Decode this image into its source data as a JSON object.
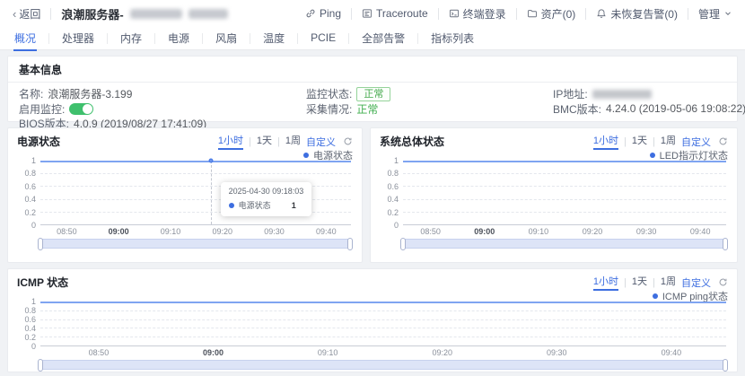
{
  "header": {
    "back_label": "返回",
    "title": "浪潮服务器-",
    "actions": [
      {
        "label": "Ping",
        "icon": "link-icon"
      },
      {
        "label": "Traceroute",
        "icon": "route-icon"
      },
      {
        "label": "终端登录",
        "icon": "terminal-icon"
      },
      {
        "label": "资产(0)",
        "icon": "folder-icon"
      },
      {
        "label": "未恢复告警(0)",
        "icon": "bell-icon"
      },
      {
        "label": "管理",
        "icon": "chevron-down-icon"
      }
    ]
  },
  "tabs": {
    "active": "概况",
    "items": [
      "概况",
      "处理器",
      "内存",
      "电源",
      "风扇",
      "温度",
      "PCIE",
      "全部告警",
      "指标列表"
    ]
  },
  "basic_info": {
    "title": "基本信息",
    "name_label": "名称:",
    "name_value": "浪潮服务器-3.199",
    "monitor_toggle_label": "启用监控:",
    "bios_label": "BIOS版本:",
    "bios_value": "4.0.9 (2019/08/27 17:41:09)",
    "monitor_status_label": "监控状态:",
    "monitor_status_value": "正常",
    "collect_label": "采集情况:",
    "collect_value": "正常",
    "ip_label": "IP地址:",
    "bmc_label": "BMC版本:",
    "bmc_value": "4.24.0 (2019-05-06 19:08:22)"
  },
  "range_picker": {
    "hour": "1小时",
    "day": "1天",
    "week": "1周",
    "custom": "自定义",
    "active": "1小时"
  },
  "colors": {
    "primary_blue": "#3D6EE0",
    "line_blue": "#7FA4F1",
    "success_green": "#3fae4e",
    "brush_fill": "#dde4f7"
  },
  "chart_data": [
    {
      "type": "line",
      "title": "电源状态",
      "legend": "电源状态",
      "x": [
        "08:50",
        "09:00",
        "09:10",
        "09:20",
        "09:30",
        "09:40"
      ],
      "y_ticks": [
        "1",
        "0.8",
        "0.6",
        "0.4",
        "0.2",
        "0"
      ],
      "ylim": [
        0,
        1
      ],
      "xrange": [
        "08:45",
        "09:45"
      ],
      "grid": true,
      "legend_position": "top-right",
      "series": [
        {
          "name": "电源状态",
          "values": [
            1,
            1,
            1,
            1,
            1,
            1
          ]
        }
      ],
      "tooltip": {
        "time": "2025-04-30 09:18:03",
        "name": "电源状态",
        "value": "1"
      }
    },
    {
      "type": "line",
      "title": "系统总体状态",
      "legend": "LED指示灯状态",
      "x": [
        "08:50",
        "09:00",
        "09:10",
        "09:20",
        "09:30",
        "09:40"
      ],
      "y_ticks": [
        "1",
        "0.8",
        "0.6",
        "0.4",
        "0.2",
        "0"
      ],
      "ylim": [
        0,
        1
      ],
      "xrange": [
        "08:45",
        "09:45"
      ],
      "grid": true,
      "legend_position": "top-right",
      "series": [
        {
          "name": "LED指示灯状态",
          "values": [
            1,
            1,
            1,
            1,
            1,
            1
          ]
        }
      ]
    },
    {
      "type": "line",
      "title": "ICMP 状态",
      "legend": "ICMP ping状态",
      "x": [
        "08:50",
        "09:00",
        "09:10",
        "09:20",
        "09:30",
        "09:40"
      ],
      "y_ticks": [
        "1",
        "0.8",
        "0.6",
        "0.4",
        "0.2",
        "0"
      ],
      "ylim": [
        0,
        1
      ],
      "xrange": [
        "08:45",
        "09:45"
      ],
      "grid": true,
      "legend_position": "top-right",
      "series": [
        {
          "name": "ICMP ping状态",
          "values": [
            1,
            1,
            1,
            1,
            1,
            1
          ]
        }
      ]
    }
  ]
}
